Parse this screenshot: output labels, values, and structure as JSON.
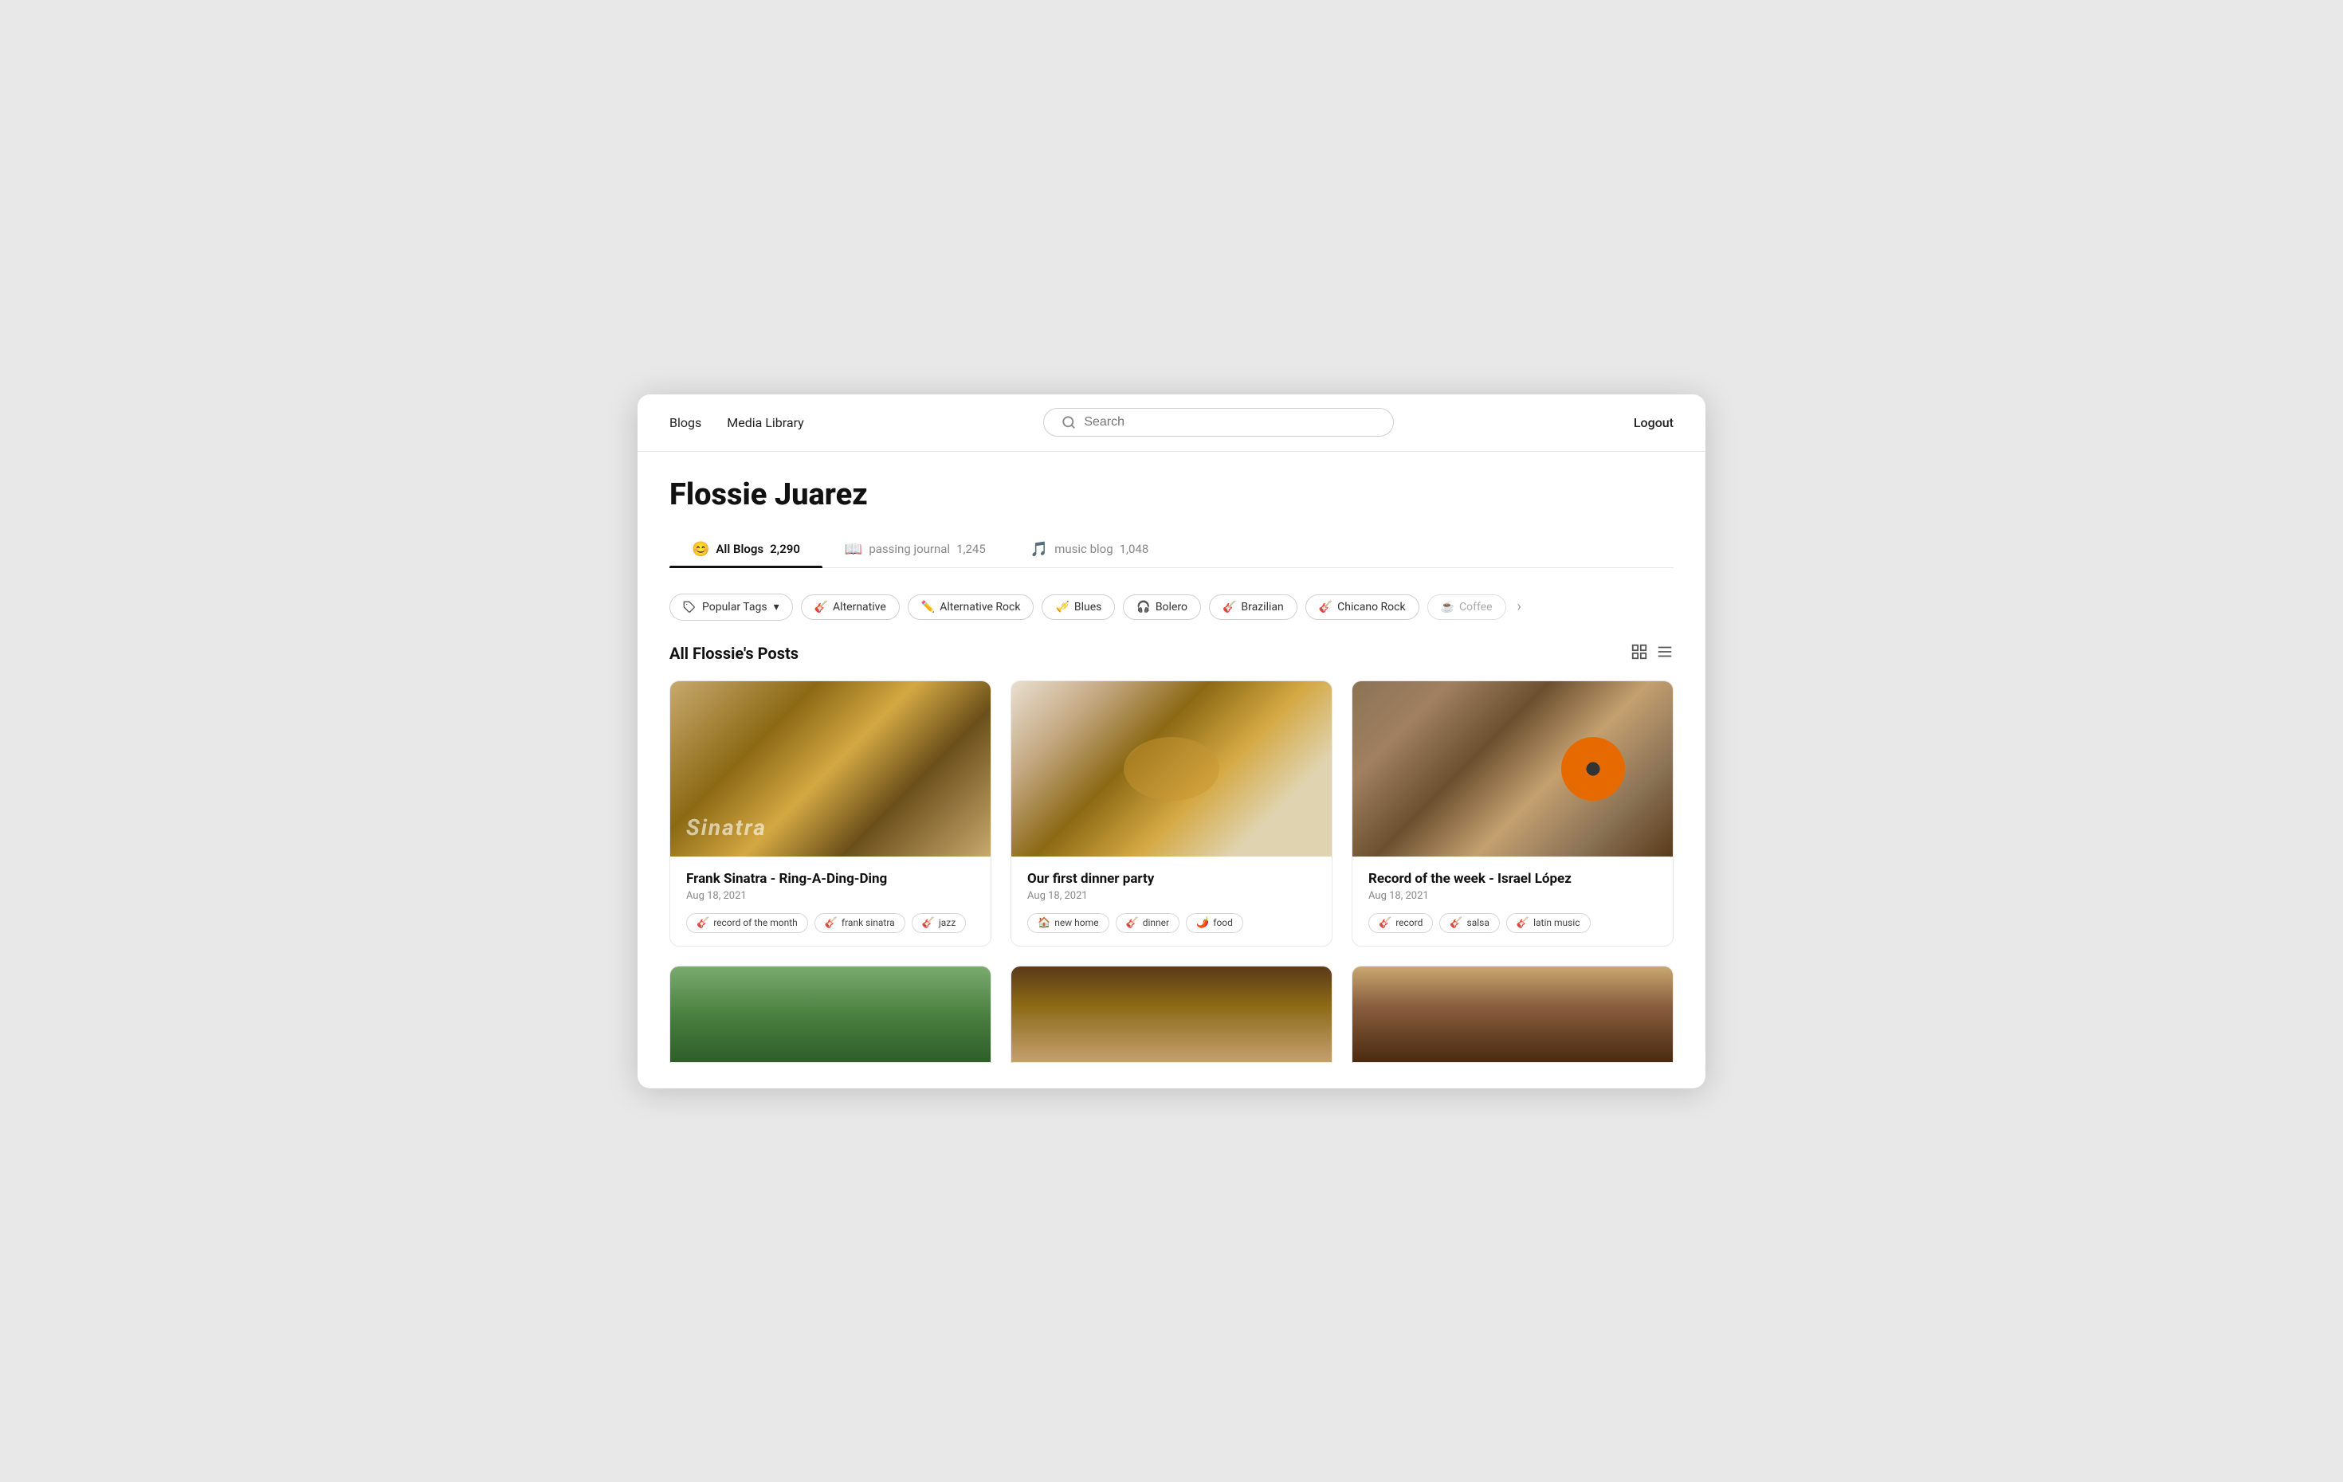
{
  "header": {
    "nav": [
      {
        "label": "Blogs",
        "id": "blogs"
      },
      {
        "label": "Media Library",
        "id": "media-library"
      }
    ],
    "search": {
      "placeholder": "Search"
    },
    "logout_label": "Logout"
  },
  "profile": {
    "name": "Flossie Juarez",
    "tabs": [
      {
        "label": "All Blogs",
        "count": "2,290",
        "icon": "😊",
        "active": true,
        "id": "all-blogs"
      },
      {
        "label": "passing journal",
        "count": "1,245",
        "icon": "📖",
        "active": false,
        "id": "passing-journal"
      },
      {
        "label": "music blog",
        "count": "1,048",
        "icon": "🎵",
        "active": false,
        "id": "music-blog"
      }
    ]
  },
  "tags": {
    "popular_label": "Popular Tags",
    "chevron": "▼",
    "items": [
      {
        "label": "Alternative",
        "icon": "🎸",
        "faded": false
      },
      {
        "label": "Alternative Rock",
        "icon": "✏️",
        "faded": false
      },
      {
        "label": "Blues",
        "icon": "🎺",
        "faded": false
      },
      {
        "label": "Bolero",
        "icon": "🎧",
        "faded": false
      },
      {
        "label": "Brazilian",
        "icon": "🎸",
        "faded": false
      },
      {
        "label": "Chicano Rock",
        "icon": "🎸",
        "faded": false
      },
      {
        "label": "Coffee",
        "icon": "☕",
        "faded": true
      }
    ]
  },
  "posts": {
    "section_title": "All Flossie's Posts",
    "cards": [
      {
        "id": "card-1",
        "title": "Frank Sinatra - Ring-A-Ding-Ding",
        "date": "Aug 18, 2021",
        "img_type": "vinyl",
        "tags": [
          {
            "label": "record of the month",
            "icon": "🎸"
          },
          {
            "label": "frank sinatra",
            "icon": "🎸"
          },
          {
            "label": "jazz",
            "icon": "🎸"
          }
        ]
      },
      {
        "id": "card-2",
        "title": "Our first dinner party",
        "date": "Aug 18, 2021",
        "img_type": "food",
        "tags": [
          {
            "label": "new home",
            "icon": "🏠"
          },
          {
            "label": "dinner",
            "icon": "🎸"
          },
          {
            "label": "food",
            "icon": "🌶️"
          }
        ]
      },
      {
        "id": "card-3",
        "title": "Record of the week - Israel López",
        "date": "Aug 18, 2021",
        "img_type": "record",
        "tags": [
          {
            "label": "record",
            "icon": "🎸"
          },
          {
            "label": "salsa",
            "icon": "🎸"
          },
          {
            "label": "latin music",
            "icon": "🎸"
          }
        ]
      }
    ],
    "bottom_cards": [
      {
        "id": "bottom-1",
        "img_type": "green"
      },
      {
        "id": "bottom-2",
        "img_type": "brown"
      },
      {
        "id": "bottom-3",
        "img_type": "tan"
      }
    ]
  }
}
